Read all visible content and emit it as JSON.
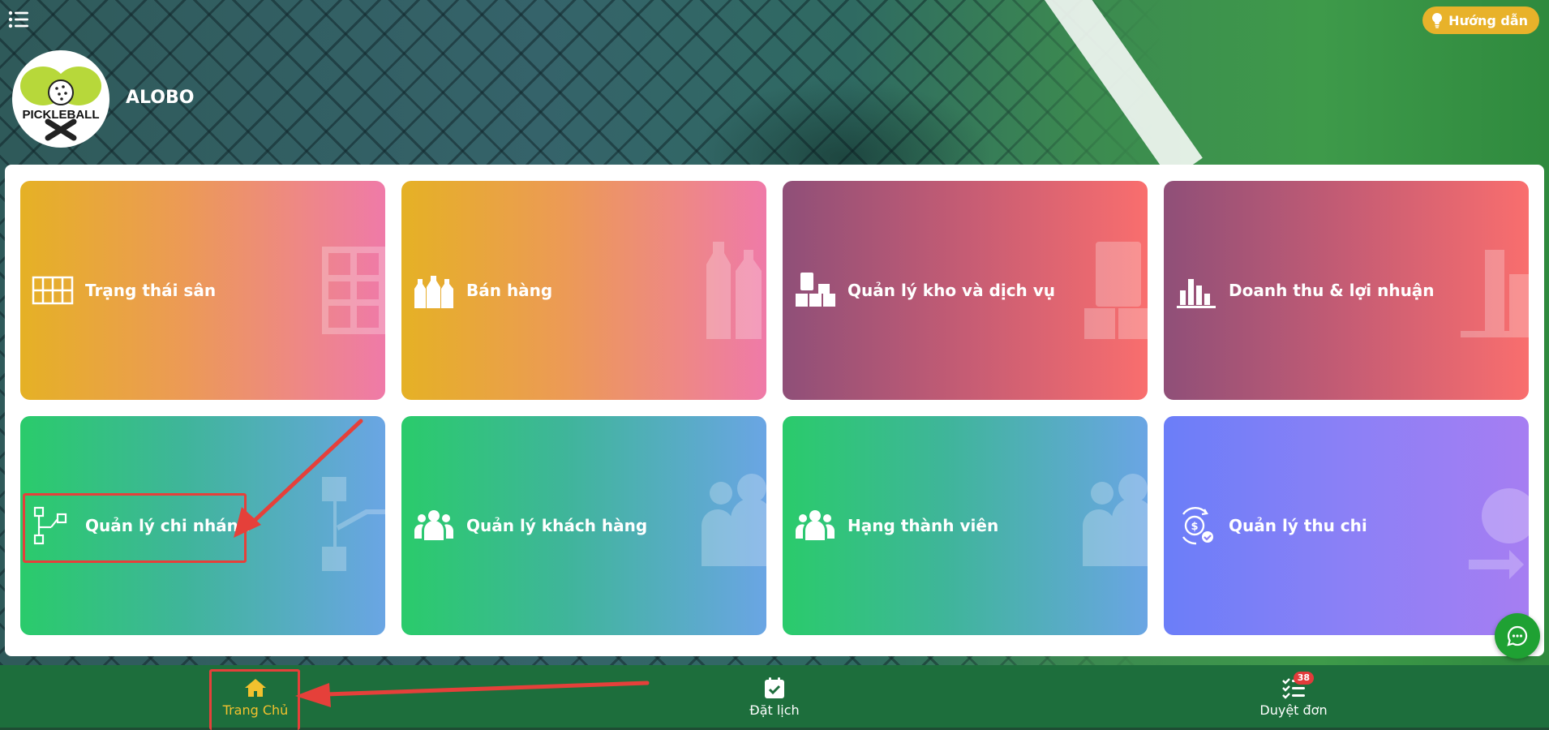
{
  "header": {
    "brand_name": "ALOBO",
    "logo_text": "PICKLEBALL",
    "guide_label": "Hướng dẫn"
  },
  "tiles": [
    {
      "label": "Trạng thái sân",
      "icon": "court-grid-icon"
    },
    {
      "label": "Bán hàng",
      "icon": "bottles-icon"
    },
    {
      "label": "Quản lý kho và dịch vụ",
      "icon": "warehouse-boxes-icon"
    },
    {
      "label": "Doanh thu & lợi nhuận",
      "icon": "bar-chart-icon"
    },
    {
      "label": "Quản lý chi nhánh",
      "icon": "branch-tree-icon"
    },
    {
      "label": "Quản lý khách hàng",
      "icon": "users-group-icon"
    },
    {
      "label": "Hạng thành viên",
      "icon": "users-group-icon"
    },
    {
      "label": "Quản lý thu chi",
      "icon": "money-exchange-icon"
    }
  ],
  "bottom_nav": [
    {
      "label": "Trang Chủ",
      "icon": "home-icon",
      "active": true
    },
    {
      "label": "Đặt lịch",
      "icon": "calendar-check-icon",
      "active": false
    },
    {
      "label": "Duyệt đơn",
      "icon": "checklist-icon",
      "badge": "38",
      "active": false
    }
  ],
  "colors": {
    "nav_bg": "#1d6e3c",
    "active_nav": "#f2c12e",
    "guide_button": "#e8b22a",
    "highlight": "#e5403a",
    "chat_fab": "#1fa133"
  }
}
